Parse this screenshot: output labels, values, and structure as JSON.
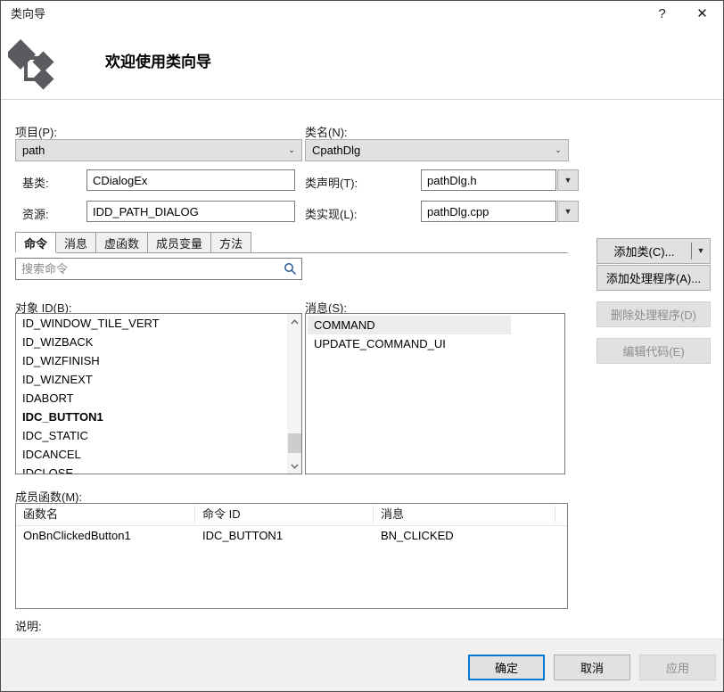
{
  "window": {
    "title": "类向导",
    "help_glyph": "?",
    "close_glyph": "✕"
  },
  "header": {
    "title": "欢迎使用类向导",
    "icon": "class-wizard-icon"
  },
  "form": {
    "project_label": "项目(P):",
    "project_value": "path",
    "class_name_label": "类名(N):",
    "class_name_value": "CpathDlg",
    "base_class_label": "基类:",
    "base_class_value": "CDialogEx",
    "class_decl_label": "类声明(T):",
    "class_decl_value": "pathDlg.h",
    "resource_label": "资源:",
    "resource_value": "IDD_PATH_DIALOG",
    "class_impl_label": "类实现(L):",
    "class_impl_value": "pathDlg.cpp",
    "add_class_label": "添加类(C)...",
    "dropdown_glyph": "▼",
    "chevron_glyph": "⌄"
  },
  "tabs": [
    {
      "label": "命令",
      "active": true
    },
    {
      "label": "消息",
      "active": false
    },
    {
      "label": "虚函数",
      "active": false
    },
    {
      "label": "成员变量",
      "active": false
    },
    {
      "label": "方法",
      "active": false
    }
  ],
  "search": {
    "placeholder": "搜索命令",
    "value": "",
    "icon": "search-icon"
  },
  "object_ids": {
    "label": "对象 ID(B):",
    "items": [
      {
        "text": "ID_WINDOW_TILE_VERT",
        "bold": false
      },
      {
        "text": "ID_WIZBACK",
        "bold": false
      },
      {
        "text": "ID_WIZFINISH",
        "bold": false
      },
      {
        "text": "ID_WIZNEXT",
        "bold": false
      },
      {
        "text": "IDABORT",
        "bold": false
      },
      {
        "text": "IDC_BUTTON1",
        "bold": true
      },
      {
        "text": "IDC_STATIC",
        "bold": false
      },
      {
        "text": "IDCANCEL",
        "bold": false
      },
      {
        "text": "IDCLOSE",
        "bold": false
      }
    ]
  },
  "messages": {
    "label": "消息(S):",
    "items": [
      {
        "text": "COMMAND",
        "selected": true
      },
      {
        "text": "UPDATE_COMMAND_UI",
        "selected": false
      }
    ]
  },
  "side_buttons": [
    {
      "label": "添加处理程序(A)...",
      "disabled": false
    },
    {
      "label": "删除处理程序(D)",
      "disabled": true
    },
    {
      "label": "编辑代码(E)",
      "disabled": true
    }
  ],
  "member_functions": {
    "label": "成员函数(M):",
    "columns": [
      "函数名",
      "命令 ID",
      "消息"
    ],
    "rows": [
      [
        "OnBnClickedButton1",
        "IDC_BUTTON1",
        "BN_CLICKED"
      ]
    ]
  },
  "description": {
    "label": "说明:",
    "text": ""
  },
  "footer": {
    "ok": "确定",
    "cancel": "取消",
    "apply": "应用"
  },
  "colors": {
    "accent": "#0078d7",
    "button_face": "#e1e1e1",
    "button_border": "#adadad",
    "disabled_text": "#8d8d8d",
    "icon_gray": "#5a5a5a",
    "search_icon": "#2b579a"
  }
}
